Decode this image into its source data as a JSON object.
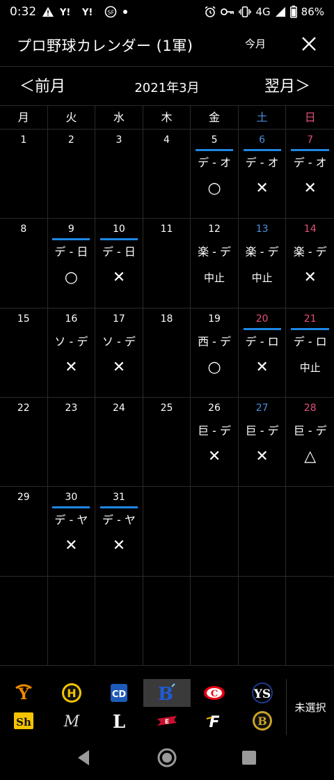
{
  "status_bar": {
    "time": "0:32",
    "network": "4G",
    "battery": "86%"
  },
  "app_bar": {
    "title": "プロ野球カレンダー (1軍)",
    "this_month_label": "今月"
  },
  "month_nav": {
    "prev_label": "＜前月",
    "title": "2021年3月",
    "next_label": "翌月＞"
  },
  "weekdays": [
    {
      "label": "月",
      "kind": "wd"
    },
    {
      "label": "火",
      "kind": "wd"
    },
    {
      "label": "水",
      "kind": "wd"
    },
    {
      "label": "木",
      "kind": "wd"
    },
    {
      "label": "金",
      "kind": "wd"
    },
    {
      "label": "土",
      "kind": "sat"
    },
    {
      "label": "日",
      "kind": "sun"
    }
  ],
  "days": [
    {
      "day": "1",
      "kind": "wd",
      "home": false,
      "matchup": "",
      "result": ""
    },
    {
      "day": "2",
      "kind": "wd",
      "home": false,
      "matchup": "",
      "result": ""
    },
    {
      "day": "3",
      "kind": "wd",
      "home": false,
      "matchup": "",
      "result": ""
    },
    {
      "day": "4",
      "kind": "wd",
      "home": false,
      "matchup": "",
      "result": ""
    },
    {
      "day": "5",
      "kind": "wd",
      "home": true,
      "matchup": "デ - オ",
      "result": "○"
    },
    {
      "day": "6",
      "kind": "sat",
      "home": true,
      "matchup": "デ - オ",
      "result": "✕"
    },
    {
      "day": "7",
      "kind": "sun",
      "home": true,
      "matchup": "デ - オ",
      "result": "✕"
    },
    {
      "day": "8",
      "kind": "wd",
      "home": false,
      "matchup": "",
      "result": ""
    },
    {
      "day": "9",
      "kind": "wd",
      "home": true,
      "matchup": "デ - 日",
      "result": "○"
    },
    {
      "day": "10",
      "kind": "wd",
      "home": true,
      "matchup": "デ - 日",
      "result": "✕"
    },
    {
      "day": "11",
      "kind": "wd",
      "home": false,
      "matchup": "",
      "result": ""
    },
    {
      "day": "12",
      "kind": "wd",
      "home": false,
      "matchup": "楽 - デ",
      "result": "中止"
    },
    {
      "day": "13",
      "kind": "sat",
      "home": false,
      "matchup": "楽 - デ",
      "result": "中止"
    },
    {
      "day": "14",
      "kind": "sun",
      "home": false,
      "matchup": "楽 - デ",
      "result": "✕"
    },
    {
      "day": "15",
      "kind": "wd",
      "home": false,
      "matchup": "",
      "result": ""
    },
    {
      "day": "16",
      "kind": "wd",
      "home": false,
      "matchup": "ソ - デ",
      "result": "✕"
    },
    {
      "day": "17",
      "kind": "wd",
      "home": false,
      "matchup": "ソ - デ",
      "result": "✕"
    },
    {
      "day": "18",
      "kind": "wd",
      "home": false,
      "matchup": "",
      "result": ""
    },
    {
      "day": "19",
      "kind": "wd",
      "home": false,
      "matchup": "西 - デ",
      "result": "○"
    },
    {
      "day": "20",
      "kind": "sun",
      "home": true,
      "matchup": "デ - ロ",
      "result": "✕"
    },
    {
      "day": "21",
      "kind": "sun",
      "home": true,
      "matchup": "デ - ロ",
      "result": "中止"
    },
    {
      "day": "22",
      "kind": "wd",
      "home": false,
      "matchup": "",
      "result": ""
    },
    {
      "day": "23",
      "kind": "wd",
      "home": false,
      "matchup": "",
      "result": ""
    },
    {
      "day": "24",
      "kind": "wd",
      "home": false,
      "matchup": "",
      "result": ""
    },
    {
      "day": "25",
      "kind": "wd",
      "home": false,
      "matchup": "",
      "result": ""
    },
    {
      "day": "26",
      "kind": "wd",
      "home": false,
      "matchup": "巨 - デ",
      "result": "✕"
    },
    {
      "day": "27",
      "kind": "sat",
      "home": false,
      "matchup": "巨 - デ",
      "result": "✕"
    },
    {
      "day": "28",
      "kind": "sun",
      "home": false,
      "matchup": "巨 - デ",
      "result": "△"
    },
    {
      "day": "29",
      "kind": "wd",
      "home": false,
      "matchup": "",
      "result": ""
    },
    {
      "day": "30",
      "kind": "wd",
      "home": true,
      "matchup": "デ - ヤ",
      "result": "✕"
    },
    {
      "day": "31",
      "kind": "wd",
      "home": true,
      "matchup": "デ - ヤ",
      "result": "✕"
    },
    {
      "day": "",
      "kind": "wd",
      "home": false,
      "matchup": "",
      "result": ""
    },
    {
      "day": "",
      "kind": "wd",
      "home": false,
      "matchup": "",
      "result": ""
    },
    {
      "day": "",
      "kind": "wd",
      "home": false,
      "matchup": "",
      "result": ""
    },
    {
      "day": "",
      "kind": "wd",
      "home": false,
      "matchup": "",
      "result": ""
    },
    {
      "day": "",
      "kind": "wd",
      "home": false,
      "matchup": "",
      "result": ""
    },
    {
      "day": "",
      "kind": "wd",
      "home": false,
      "matchup": "",
      "result": ""
    },
    {
      "day": "",
      "kind": "wd",
      "home": false,
      "matchup": "",
      "result": ""
    },
    {
      "day": "",
      "kind": "wd",
      "home": false,
      "matchup": "",
      "result": ""
    },
    {
      "day": "",
      "kind": "wd",
      "home": false,
      "matchup": "",
      "result": ""
    },
    {
      "day": "",
      "kind": "wd",
      "home": false,
      "matchup": "",
      "result": ""
    },
    {
      "day": "",
      "kind": "wd",
      "home": false,
      "matchup": "",
      "result": ""
    }
  ],
  "teams": [
    {
      "id": "giants",
      "icon": "giants-logo-icon",
      "selected": false
    },
    {
      "id": "tigers",
      "icon": "tigers-logo-icon",
      "selected": false
    },
    {
      "id": "dragons",
      "icon": "dragons-logo-icon",
      "selected": false
    },
    {
      "id": "baystars",
      "icon": "baystars-logo-icon",
      "selected": true
    },
    {
      "id": "carp",
      "icon": "carp-logo-icon",
      "selected": false
    },
    {
      "id": "swallows",
      "icon": "swallows-logo-icon",
      "selected": false
    },
    {
      "id": "hawks",
      "icon": "hawks-logo-icon",
      "selected": false
    },
    {
      "id": "marines",
      "icon": "marines-logo-icon",
      "selected": false
    },
    {
      "id": "lions",
      "icon": "lions-logo-icon",
      "selected": false
    },
    {
      "id": "eagles",
      "icon": "eagles-logo-icon",
      "selected": false
    },
    {
      "id": "fighters",
      "icon": "fighters-logo-icon",
      "selected": false
    },
    {
      "id": "buffaloes",
      "icon": "buffaloes-logo-icon",
      "selected": false
    }
  ],
  "unselected_label": "未選択",
  "colors": {
    "accent_blue": "#1e88e5",
    "saturday": "#4a90e2",
    "sunday": "#e5507a",
    "grid_line": "#2a2a2a"
  }
}
